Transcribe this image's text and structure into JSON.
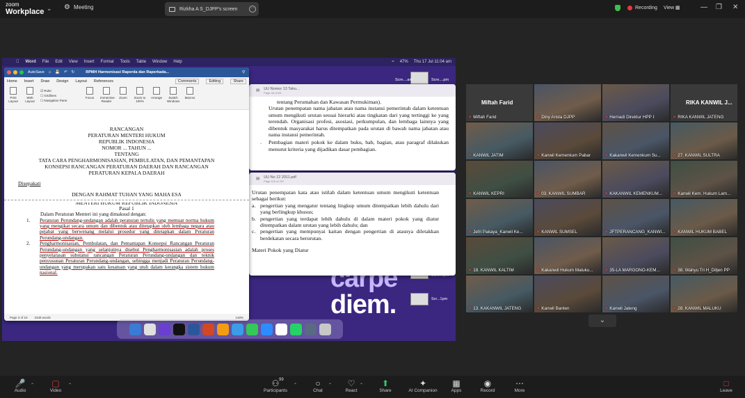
{
  "titlebar": {
    "brand_line1": "zoom",
    "brand_line2": "Workplace",
    "meeting_label": "Meeting",
    "share_tab_label": "Rizkha A S_DJPP's screen",
    "recording_label": "Recording",
    "view_label": "View",
    "colors": {
      "recording": "#e5383b",
      "shield": "#3fbf4a"
    }
  },
  "mac": {
    "app": "Word",
    "menus": [
      "File",
      "Edit",
      "View",
      "Insert",
      "Format",
      "Tools",
      "Table",
      "Window",
      "Help"
    ],
    "battery": "47%",
    "clock": "Thu 17 Jul  11:04 am"
  },
  "word": {
    "doc_title": "RPMH Harmonisasi Raperda dan Raperkada...",
    "autosave": "AutoSave",
    "ribbon_tabs": [
      "Home",
      "Insert",
      "Draw",
      "Design",
      "Layout",
      "References"
    ],
    "active_tab": "Layout",
    "comments": "Comments",
    "editing": "Editing",
    "share": "Share",
    "tools": [
      "Print Layout",
      "Web Layout",
      "Focus",
      "Immersive Reader",
      "Zoom",
      "Zoom to 100%",
      "Arrange",
      "Switch Windows",
      "Macros"
    ],
    "checks": [
      "Ruler",
      "Gridlines",
      "Navigation Pane"
    ],
    "status": [
      "Page 3 of 10",
      "2348 words"
    ],
    "zoom": "148%"
  },
  "document": {
    "heading": [
      "RANCANGAN",
      "PERATURAN MENTERI HUKUM",
      "REPUBLIK INDONESIA",
      "NOMOR ... TAHUN ...",
      "TENTANG",
      "TATA CARA PENGHARMONISASIAN, PEMBULATAN, DAN PEMANTAPAN",
      "KONSEPSI RANCANGAN PERATURAN DAERAH DAN RANCANGAN",
      "PERATURAN KEPALA DAERAH"
    ],
    "disepakati": "Disepakati",
    "rahmat": "DENGAN RAHMAT TUHAN YANG MAHA ESA",
    "menteri": "MENTERI HUKUM REPUBLIK INDONESIA",
    "pasal": "Pasal 1",
    "intro": "Dalam Peraturan Menteri ini yang dimaksud dengan:",
    "items": [
      {
        "n": "1.",
        "text": "Peraturan Perundang-undangan adalah peraturan tertulis yang memuat norma hukum yang mengikat secara umum dan dibentuk atau ditetapkan oleh lembaga negara atau pejabat yang berwenang melalui prosedur yang ditetapkan dalam Peraturan Perundang-undangan."
      },
      {
        "n": "2.",
        "text": "Pengharmonisasian, Pembulatan, dan Pemantapan Konsepsi Rancangan Peraturan Perundang-undangan yang selanjutnya disebut Pengharmonisasian adalah proses penyelarasan substansi rancangan Peraturan Perundang-undangan dan teknik penyusunan Peraturan Perundang-undangan, sehingga menjadi Peraturan Perundang-undangan yang merupakan satu kesatuan yang utuh dalam kerangka sistem hukum nasional."
      }
    ]
  },
  "preview1": {
    "title": "UU Nomor 13 Tahu...",
    "pages": "Page 43 of 63",
    "top_line": "tentang Perumahan dan Kawasan Permukiman).",
    "items": [
      {
        "n": "",
        "text": "Urutan penempatan nama jabatan atau nama instansi pemerintah dalam ketentuan umum mengikuti urutan sesuai hierarki atau tingkatan dari yang tertinggi ke yang terendah. Organisasi profesi, asosiasi, perkumpulan, dan lembaga lainnya yang dibentuk masyarakat harus ditempatkan pada urutan di bawah nama jabatan atau nama instansi pemerintah."
      },
      {
        "n": ".",
        "text": "Pembagian materi pokok ke dalam buku, bab, bagian, atau paragraf dilakukan menurut kriteria yang dijadikan dasar pembagian."
      }
    ]
  },
  "preview2": {
    "title": "UU No 12 2011.pdf",
    "pages": "Page 115 of 237",
    "intro": "Urutan penempatan kata atau istilah dalam ketentuan umum mengikuti ketentuan sebagai berikut:",
    "items": [
      {
        "n": "a.",
        "text": "pengertian yang mengatur tentang lingkup umum ditempatkan lebih dahulu dari yang berlingkup khusus;"
      },
      {
        "n": "b.",
        "text": "pengertian yang terdapat lebih dahulu di dalam materi pokok yang diatur ditempatkan dalam urutan yang lebih dahulu; dan"
      },
      {
        "n": "c.",
        "text": "pengertian yang mempunyai kaitan dengan pengertian di atasnya diletakkan berdekatan secara berurutan."
      }
    ],
    "bottom": "Materi Pokok yang Diatur"
  },
  "desktop": {
    "carpe_1": "carpe",
    "carpe_2": "diem.",
    "thumbs": [
      "Scre....am",
      "Scre....pm",
      "Scre....pm",
      "Scr...1pm"
    ]
  },
  "gallery": {
    "tiles": [
      {
        "label": "Miftah Farid",
        "big": "Miftah Farid",
        "kind": "name"
      },
      {
        "label": "Diny Arista DJPP",
        "kind": "video"
      },
      {
        "label": "Hernadi Direktur HPP I",
        "kind": "video",
        "active": true
      },
      {
        "label": "RIKA KANWIL JATENG",
        "big": "RIKA KANWIL J...",
        "kind": "name"
      },
      {
        "label": "KANWIL JATIM",
        "kind": "video"
      },
      {
        "label": "Kanwil Kemenkum Pabar",
        "kind": "video"
      },
      {
        "label": "Kakanwil Kemenkum Su...",
        "kind": "video"
      },
      {
        "label": "27. KANWIL SULTRA",
        "kind": "video"
      },
      {
        "label": "KANWIL KEPRI",
        "kind": "video"
      },
      {
        "label": "03. KANWIL SUMBAR",
        "kind": "video"
      },
      {
        "label": "KAKANWIL KEMENKUM...",
        "kind": "video"
      },
      {
        "label": "Kanwil Kem. Hukum Lam...",
        "kind": "video"
      },
      {
        "label": "Jefri Pakaya_Kanwil Ke...",
        "kind": "video"
      },
      {
        "label": "KANWIL SUMSEL",
        "kind": "video"
      },
      {
        "label": "JFTPERANCANG_KANWI...",
        "kind": "video"
      },
      {
        "label": "KANWIL HUKUM BABEL",
        "kind": "video"
      },
      {
        "label": "18. KANWIL KALTIM",
        "kind": "video"
      },
      {
        "label": "Kakanwil Hukum Maluku...",
        "kind": "video"
      },
      {
        "label": "35-LA MARGONO-KEM...",
        "kind": "video"
      },
      {
        "label": "38. Wahyu Tri H_Ditjen PP",
        "kind": "video"
      },
      {
        "label": "13. KAKANWIL JATENG",
        "kind": "video"
      },
      {
        "label": "Kanwil Banten",
        "kind": "video"
      },
      {
        "label": "Kanwil Jateng",
        "kind": "video"
      },
      {
        "label": "28. KANWIL MALUKU",
        "kind": "video"
      }
    ]
  },
  "toolbar": {
    "audio": "Audio",
    "video": "Video",
    "participants": "Participants",
    "participants_count": "99",
    "chat": "Chat",
    "react": "React",
    "share": "Share",
    "ai": "AI Companion",
    "apps": "Apps",
    "record": "Record",
    "more": "More",
    "leave": "Leave",
    "colors": {
      "share": "#2ecc71",
      "leave": "#e5383b",
      "muted": "#e5383b"
    }
  }
}
